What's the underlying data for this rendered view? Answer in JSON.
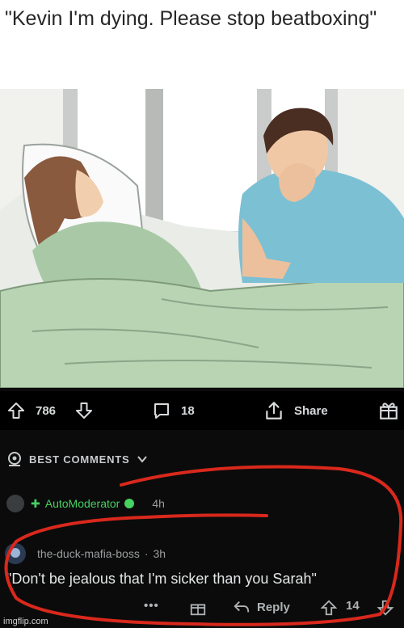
{
  "meme": {
    "caption": "\"Kevin I'm dying. Please stop beatboxing\""
  },
  "post_actions": {
    "upvotes": "786",
    "comments": "18",
    "share_label": "Share"
  },
  "comments_header": {
    "sort_label": "BEST COMMENTS"
  },
  "auto_comment": {
    "author": "AutoModerator",
    "age": "4h"
  },
  "top_comment": {
    "author": "the-duck-mafia-boss",
    "age": "3h",
    "text": "\"Don't be jealous that I'm sicker than you Sarah\"",
    "reply_label": "Reply",
    "score": "14",
    "more_label": "•••"
  },
  "watermark": "imgflip.com",
  "colors": {
    "background": "#0b0b0b",
    "annotation_red": "#d9281c",
    "mod_green": "#46d160",
    "username_gray": "#9a9d9f"
  },
  "icons": [
    "upvote-icon",
    "downvote-icon",
    "comment-icon",
    "share-icon",
    "award-icon",
    "best-sort-icon",
    "chevron-down-icon",
    "avatar",
    "reply-icon"
  ]
}
